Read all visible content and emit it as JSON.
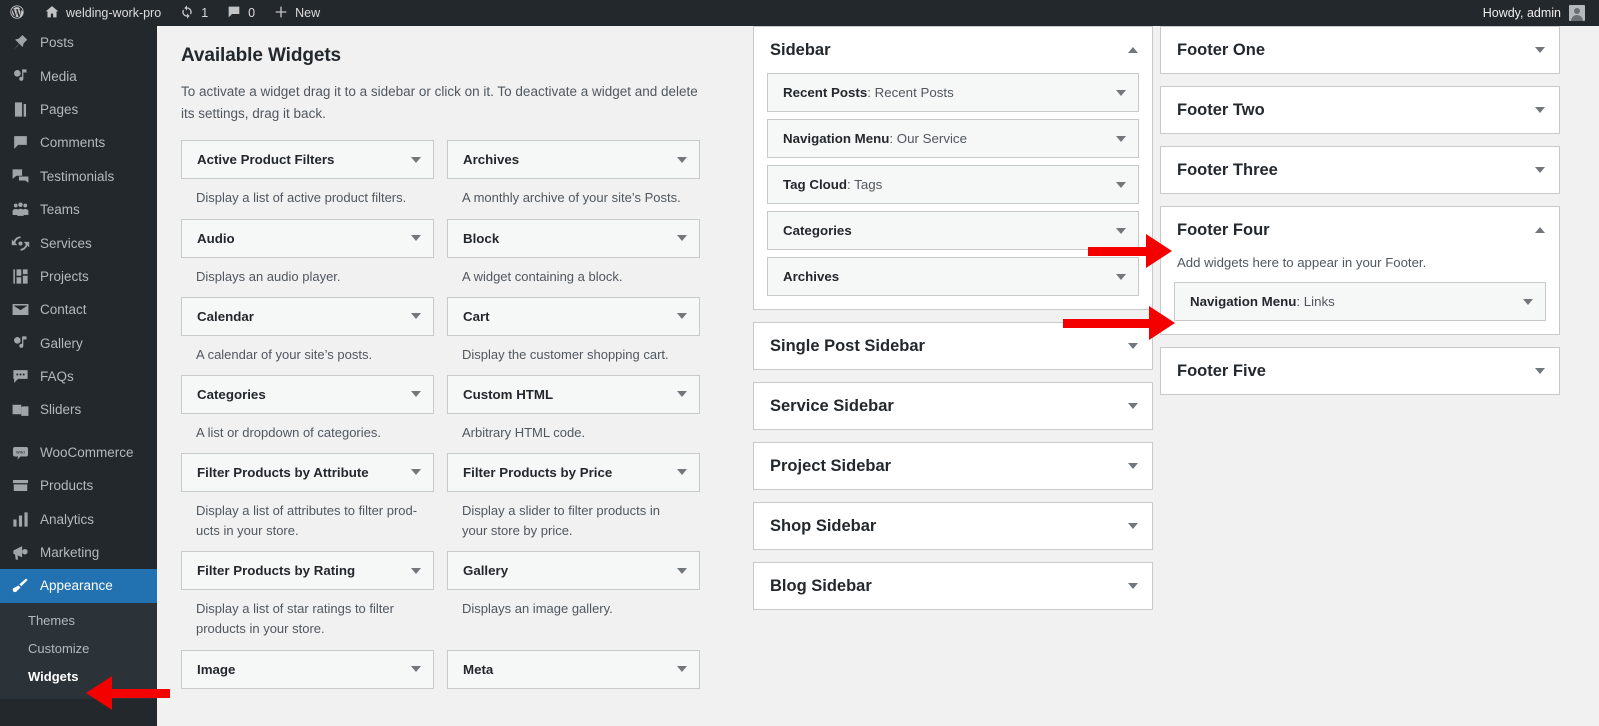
{
  "adminbar": {
    "logo_icon": "wordpress-logo-icon",
    "site_icon": "home-icon",
    "site_name": "welding-work-pro",
    "updates_icon": "updates-icon",
    "updates_count": "1",
    "comments_icon": "comment-bubble-icon",
    "comments_count": "0",
    "new_icon": "plus-icon",
    "new_label": "New",
    "howdy": "Howdy, admin",
    "avatar_icon": "user-avatar-icon"
  },
  "adminmenu": {
    "items": [
      {
        "label": "Posts",
        "icon": "pin-icon"
      },
      {
        "label": "Media",
        "icon": "media-icon"
      },
      {
        "label": "Pages",
        "icon": "pages-icon"
      },
      {
        "label": "Comments",
        "icon": "comment-icon"
      },
      {
        "label": "Testimonials",
        "icon": "testimonials-icon"
      },
      {
        "label": "Teams",
        "icon": "teams-icon"
      },
      {
        "label": "Services",
        "icon": "services-icon"
      },
      {
        "label": "Projects",
        "icon": "projects-icon"
      },
      {
        "label": "Contact",
        "icon": "envelope-icon"
      },
      {
        "label": "Gallery",
        "icon": "gallery-icon"
      },
      {
        "label": "FAQs",
        "icon": "faq-icon"
      },
      {
        "label": "Sliders",
        "icon": "sliders-icon"
      },
      {
        "label": "WooCommerce",
        "icon": "woocommerce-icon"
      },
      {
        "label": "Products",
        "icon": "products-icon"
      },
      {
        "label": "Analytics",
        "icon": "analytics-icon"
      },
      {
        "label": "Marketing",
        "icon": "marketing-icon"
      },
      {
        "label": "Appearance",
        "icon": "appearance-brush-icon",
        "current": true
      }
    ],
    "submenu": [
      {
        "label": "Themes"
      },
      {
        "label": "Customize"
      },
      {
        "label": "Widgets",
        "current": true
      }
    ]
  },
  "available": {
    "heading": "Available Widgets",
    "description": "To activate a widget drag it to a sidebar or click on it. To deactivate a widget and delete its settings, drag it back.",
    "widgets": [
      {
        "title": "Active Product Filters",
        "desc": "Display a list of active product filters."
      },
      {
        "title": "Archives",
        "desc": "A monthly archive of your site’s Posts."
      },
      {
        "title": "Audio",
        "desc": "Displays an audio player."
      },
      {
        "title": "Block",
        "desc": "A widget containing a block."
      },
      {
        "title": "Calendar",
        "desc": "A calendar of your site’s posts."
      },
      {
        "title": "Cart",
        "desc": "Display the customer shopping cart."
      },
      {
        "title": "Categories",
        "desc": "A list or dropdown of categories."
      },
      {
        "title": "Custom HTML",
        "desc": "Arbitrary HTML code."
      },
      {
        "title": "Filter Products by Attribute",
        "desc": "Display a list of attributes to filter prod­ucts in your store."
      },
      {
        "title": "Filter Products by Price",
        "desc": "Display a slider to filter products in your store by price."
      },
      {
        "title": "Filter Products by Rating",
        "desc": "Display a list of star ratings to filter prod­ucts in your store."
      },
      {
        "title": "Gallery",
        "desc": "Displays an image gallery."
      },
      {
        "title": "Image",
        "desc": ""
      },
      {
        "title": "Meta",
        "desc": ""
      }
    ]
  },
  "middle_column": {
    "panels": [
      {
        "title": "Sidebar",
        "expanded": true,
        "toggle_icon": "chevron-up-icon",
        "widgets": [
          {
            "label": "Recent Posts",
            "value": "Recent Posts"
          },
          {
            "label": "Navigation Menu",
            "value": "Our Service"
          },
          {
            "label": "Tag Cloud",
            "value": "Tags"
          },
          {
            "label": "Categories",
            "value": ""
          },
          {
            "label": "Archives",
            "value": ""
          }
        ]
      },
      {
        "title": "Single Post Sidebar",
        "expanded": false,
        "toggle_icon": "chevron-down-icon",
        "widgets": []
      },
      {
        "title": "Service Sidebar",
        "expanded": false,
        "toggle_icon": "chevron-down-icon",
        "widgets": []
      },
      {
        "title": "Project Sidebar",
        "expanded": false,
        "toggle_icon": "chevron-down-icon",
        "widgets": []
      },
      {
        "title": "Shop Sidebar",
        "expanded": false,
        "toggle_icon": "chevron-down-icon",
        "widgets": []
      },
      {
        "title": "Blog Sidebar",
        "expanded": false,
        "toggle_icon": "chevron-down-icon",
        "widgets": []
      }
    ]
  },
  "right_column": {
    "panels": [
      {
        "title": "Footer One",
        "expanded": false,
        "toggle_icon": "chevron-down-icon",
        "note": "",
        "widgets": []
      },
      {
        "title": "Footer Two",
        "expanded": false,
        "toggle_icon": "chevron-down-icon",
        "note": "",
        "widgets": []
      },
      {
        "title": "Footer Three",
        "expanded": false,
        "toggle_icon": "chevron-down-icon",
        "note": "",
        "widgets": []
      },
      {
        "title": "Footer Four",
        "expanded": true,
        "toggle_icon": "chevron-up-icon",
        "note": "Add widgets here to appear in your Footer.",
        "widgets": [
          {
            "label": "Navigation Menu",
            "value": "Links"
          }
        ]
      },
      {
        "title": "Footer Five",
        "expanded": false,
        "toggle_icon": "chevron-down-icon",
        "note": "",
        "widgets": []
      }
    ]
  },
  "annotations": {
    "color": "#f40000",
    "arrows": [
      {
        "name": "arrow-to-footer-four",
        "direction": "right"
      },
      {
        "name": "arrow-to-navigation-menu-links",
        "direction": "right"
      },
      {
        "name": "arrow-to-widgets-menu",
        "direction": "left"
      }
    ]
  }
}
